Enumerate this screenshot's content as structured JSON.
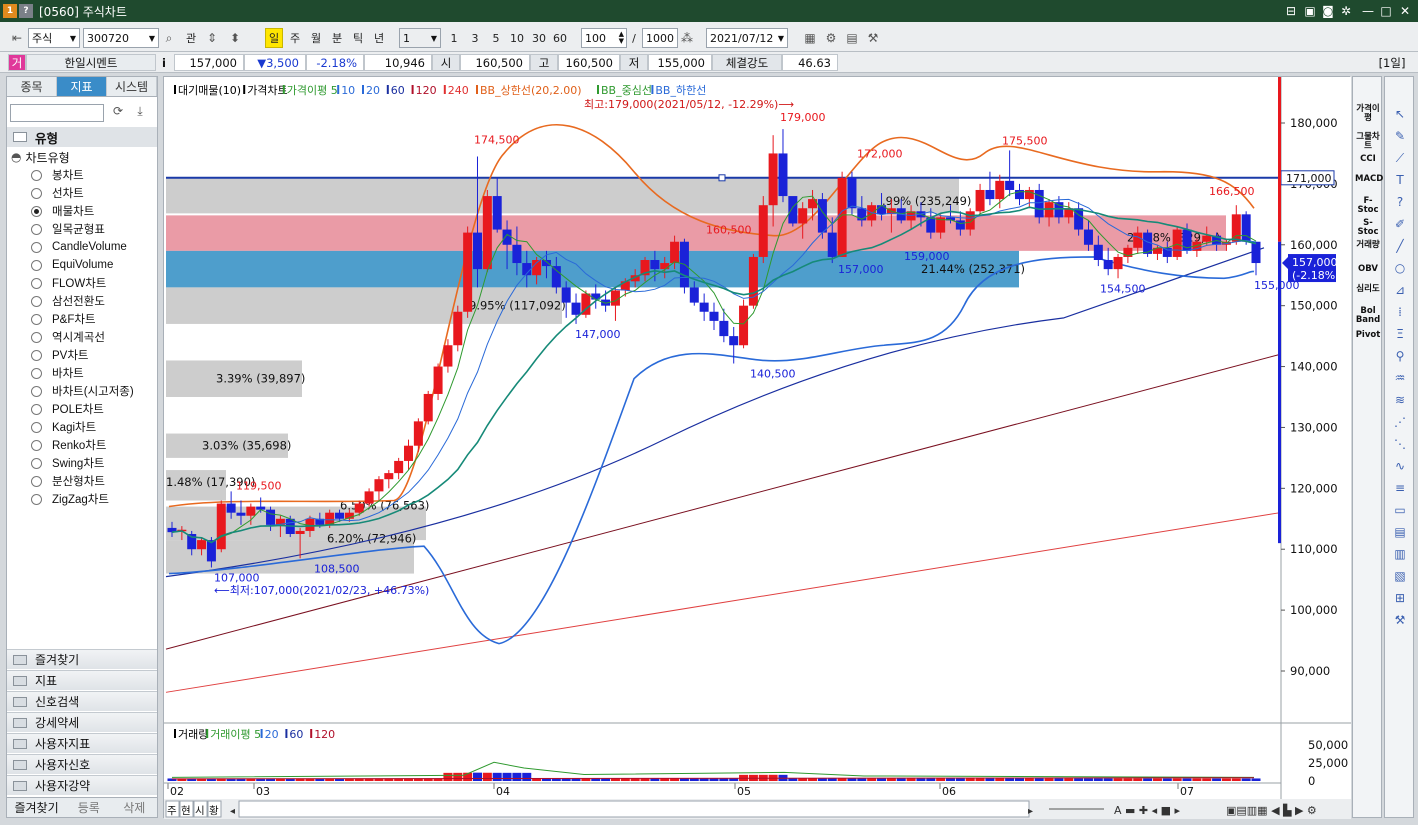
{
  "window": {
    "sys_icons": [
      "1",
      "?"
    ],
    "title": "[0560] 주식차트"
  },
  "toolbar": {
    "market": "주식",
    "code": "300720",
    "btn_interest": "관",
    "periods": [
      "일",
      "주",
      "월",
      "분",
      "틱",
      "년"
    ],
    "active_period": "일",
    "interval_value": "1",
    "minute_presets": [
      "1",
      "3",
      "5",
      "10",
      "30",
      "60"
    ],
    "count": "100",
    "total": "1000",
    "date": "2021/07/12"
  },
  "infobar": {
    "mark": "거",
    "info_icon": "i",
    "name": "한일시멘트",
    "price": "157,000",
    "change": "▼3,500",
    "change_pct": "-2.18%",
    "volume": "10,946",
    "open_label": "시",
    "open": "160,500",
    "high_label": "고",
    "high": "160,500",
    "low_label": "저",
    "low": "155,000",
    "strength_label": "체결강도",
    "strength": "46.63",
    "period_tag": "[1일]"
  },
  "sidebar": {
    "tabs": [
      "종목",
      "지표",
      "시스템"
    ],
    "active_tab": "지표",
    "group_header": "유형",
    "tree_root": "차트유형",
    "chart_types": [
      "봉차트",
      "선차트",
      "매물차트",
      "일목균형표",
      "CandleVolume",
      "EquiVolume",
      "FLOW차트",
      "삼선전환도",
      "P&F차트",
      "역시계곡선",
      "PV차트",
      "바차트",
      "바차트(시고저종)",
      "POLE차트",
      "Kagi차트",
      "Renko차트",
      "Swing차트",
      "분산형차트",
      "ZigZag차트"
    ],
    "selected_type": "매물차트",
    "folders": [
      "즐겨찾기",
      "지표",
      "신호검색",
      "강세약세",
      "사용자지표",
      "사용자신호",
      "사용자강약"
    ],
    "bottom_tabs": [
      "즐겨찾기",
      "등록",
      "삭제"
    ]
  },
  "chart_legend": {
    "items": [
      "대기매물(10)",
      "가격차트",
      "가격이평 5",
      "10",
      "20",
      "60",
      "120",
      "240",
      "BB_상한선(20,2.00)",
      "BB_중심선",
      "BB_하한선"
    ],
    "colors": [
      "#000000",
      "#000000",
      "#2f9a2f",
      "#2a6ad8",
      "#2a6ad8",
      "#1a2fa0",
      "#b0102a",
      "#e03030",
      "#e0601a",
      "#2f9a2f",
      "#2a6ad8"
    ]
  },
  "volume_legend": {
    "items": [
      "거래량",
      "거래이평 5",
      "20",
      "60",
      "120"
    ],
    "colors": [
      "#000000",
      "#2f9a2f",
      "#2a6ad8",
      "#1a2fa0",
      "#b0102a"
    ]
  },
  "annotations": {
    "high_note": "최고:179,000(2021/05/12, -12.29%)⟶",
    "low_note": "⟵최저:107,000(2021/02/23, +46.73%)",
    "current_line_label": "171,000",
    "last_price_label": "157,000",
    "last_change_label": "(-2.18%)"
  },
  "chart_data": {
    "type": "candlestick",
    "y_axis_ticks": [
      "180,000",
      "170,000",
      "160,000",
      "150,000",
      "140,000",
      "130,000",
      "120,000",
      "110,000",
      "100,000",
      "90,000"
    ],
    "x_axis_ticks": [
      "02",
      "03",
      "04",
      "05",
      "06",
      "07"
    ],
    "ylim": [
      84000,
      186000
    ],
    "peak_labels": [
      "174,500",
      "179,000",
      "172,000",
      "175,500",
      "166,500",
      "119,500",
      "160,500"
    ],
    "trough_labels": [
      "107,000",
      "108,500",
      "147,000",
      "140,500",
      "157,000",
      "159,000",
      "154,500",
      "155,000"
    ],
    "volume_profile": [
      {
        "price_low": 165000,
        "price_high": 171000,
        "label": "",
        "pct": null
      },
      {
        "price_low": 159000,
        "price_high": 165000,
        "label": "",
        "pct": null
      },
      {
        "price_low": 153000,
        "price_high": 159000,
        "label": "21.44% (252,371)",
        "pct": 21.44
      },
      {
        "price_low": 147000,
        "price_high": 153000,
        "label": "9.95% (117,092)",
        "pct": 9.95
      },
      {
        "price_low": 141000,
        "price_high": 147000,
        "label": "3.39% (39,897)",
        "pct": 3.39
      },
      {
        "price_low": 129000,
        "price_high": 135000,
        "label": "3.03% (35,698)",
        "pct": 3.03
      },
      {
        "price_low": 123000,
        "price_high": 129000,
        "label": "1.48% (17,390)",
        "pct": 1.48
      },
      {
        "price_low": 117000,
        "price_high": 123000,
        "label": "6.50% (76,563)",
        "pct": 6.5
      },
      {
        "price_low": 111000,
        "price_high": 117000,
        "label": "6.20% (72,946)",
        "pct": 6.2
      },
      {
        "price_low": 165000,
        "price_high": 171000,
        "label": ".99% (235,249)",
        "pct": 19.99
      },
      {
        "price_low": 159000,
        "price_high": 165000,
        "label": "28.08% (329,...)",
        "pct": 28.08
      }
    ],
    "volume_axis_ticks": [
      "50,000",
      "25,000",
      "0"
    ]
  },
  "bottom": {
    "tabs": [
      "주",
      "현",
      "시",
      "황"
    ]
  },
  "rightbar": {
    "indicators": [
      "가격이평",
      "그물차트",
      "CCI",
      "MACD",
      "F-Stoc",
      "S-Stoc",
      "거래량",
      "OBV",
      "심리도",
      "Bol Band",
      "Pivot"
    ]
  }
}
